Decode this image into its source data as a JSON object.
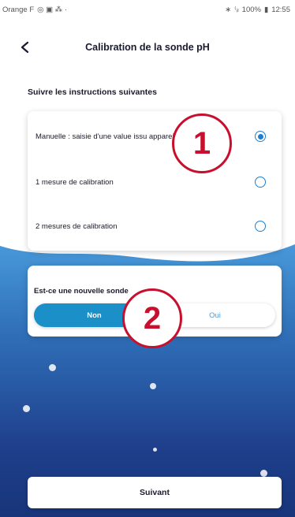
{
  "status_bar": {
    "carrier": "Orange F",
    "battery": "100%",
    "time": "12:55"
  },
  "header": {
    "title": "Calibration de la sonde pH"
  },
  "instructions": "Suivre les instructions suivantes",
  "options": [
    {
      "label": "Manuelle : saisie d'une value issu appareil",
      "selected": true
    },
    {
      "label": "1 mesure de calibration",
      "selected": false
    },
    {
      "label": "2 mesures de calibration",
      "selected": false
    }
  ],
  "question": {
    "label": "Est-ce une nouvelle sonde",
    "options": [
      "Non",
      "Oui"
    ],
    "selected": "Non"
  },
  "next_button": "Suivant",
  "badges": [
    "1",
    "2"
  ],
  "colors": {
    "accent": "#1b8fc7",
    "badge": "#c8102e"
  }
}
